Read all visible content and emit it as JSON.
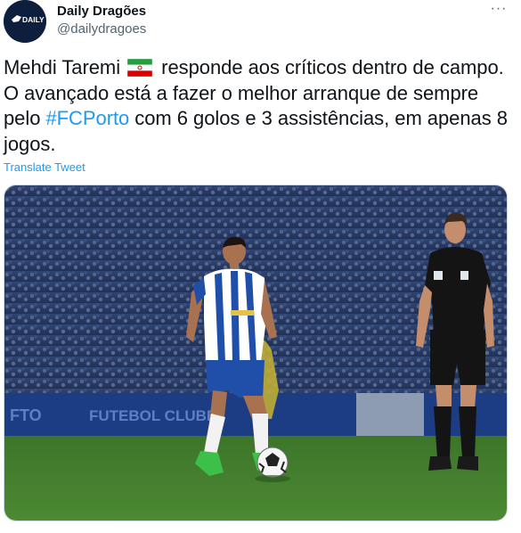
{
  "author": {
    "name": "Daily Dragões",
    "handle": "@dailydragoes",
    "avatar_logo_text": "DAILY DRAGÕES"
  },
  "more_icon": "more-horizontal-icon",
  "tweet": {
    "text_before_flag": "Mehdi Taremi",
    "flag_icon": "iran-flag-icon",
    "text_after_flag": " responde aos críticos dentro de campo. O avançado está a fazer o melhor arranque de sempre pelo ",
    "hashtag": "#FCPorto",
    "text_after_hashtag": " com 6 golos e 3 assistências, em apenas 8 jogos."
  },
  "translate_label": "Translate Tweet",
  "media": {
    "description_icon": "photo",
    "board_text_left": "FTO",
    "board_text_mid": "FUTEBOL CLUBE",
    "colors": {
      "pitch": "#3f7a2c",
      "stands": "#2a3f6b",
      "porto_blue": "#1f4fa8",
      "referee_black": "#141414"
    }
  },
  "colors": {
    "link": "#1d9bf0",
    "text": "#0f1419",
    "secondary": "#536471"
  }
}
